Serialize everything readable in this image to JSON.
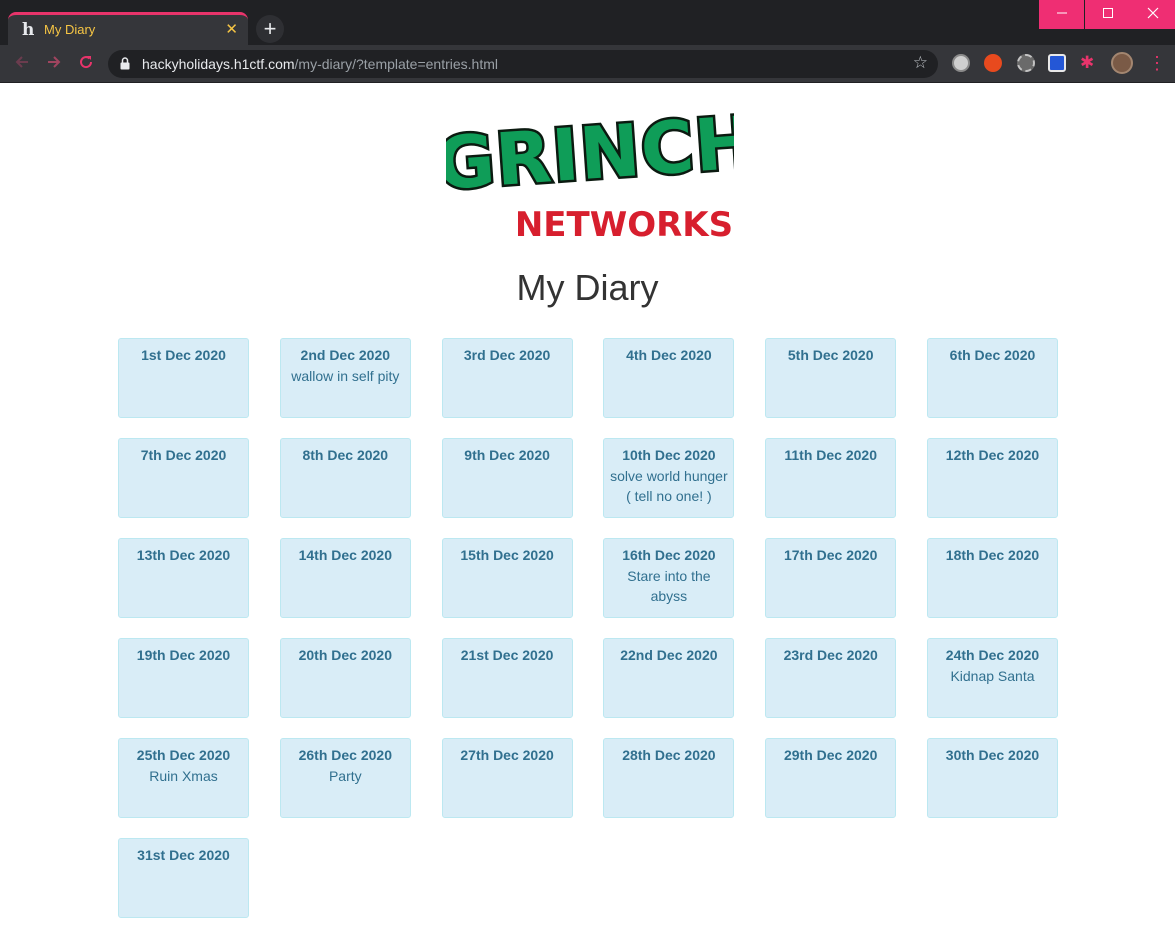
{
  "browser": {
    "tab_title": "My Diary",
    "tab_favicon": "h",
    "tab_close": "✕",
    "new_tab": "+",
    "url_host": "hackyholidays.h1ctf.com",
    "url_path": "/my-diary/?template=entries.html",
    "accent_color": "#e8346b"
  },
  "page": {
    "logo_top": "GRINCH",
    "logo_bottom": "NETWORKS",
    "title": "My Diary"
  },
  "entries": [
    {
      "date": "1st Dec 2020",
      "text": ""
    },
    {
      "date": "2nd Dec 2020",
      "text": "wallow in self pity"
    },
    {
      "date": "3rd Dec 2020",
      "text": ""
    },
    {
      "date": "4th Dec 2020",
      "text": ""
    },
    {
      "date": "5th Dec 2020",
      "text": ""
    },
    {
      "date": "6th Dec 2020",
      "text": ""
    },
    {
      "date": "7th Dec 2020",
      "text": ""
    },
    {
      "date": "8th Dec 2020",
      "text": ""
    },
    {
      "date": "9th Dec 2020",
      "text": ""
    },
    {
      "date": "10th Dec 2020",
      "text": "solve world hunger ( tell no one! )"
    },
    {
      "date": "11th Dec 2020",
      "text": ""
    },
    {
      "date": "12th Dec 2020",
      "text": ""
    },
    {
      "date": "13th Dec 2020",
      "text": ""
    },
    {
      "date": "14th Dec 2020",
      "text": ""
    },
    {
      "date": "15th Dec 2020",
      "text": ""
    },
    {
      "date": "16th Dec 2020",
      "text": "Stare into the abyss"
    },
    {
      "date": "17th Dec 2020",
      "text": ""
    },
    {
      "date": "18th Dec 2020",
      "text": ""
    },
    {
      "date": "19th Dec 2020",
      "text": ""
    },
    {
      "date": "20th Dec 2020",
      "text": ""
    },
    {
      "date": "21st Dec 2020",
      "text": ""
    },
    {
      "date": "22nd Dec 2020",
      "text": ""
    },
    {
      "date": "23rd Dec 2020",
      "text": ""
    },
    {
      "date": "24th Dec 2020",
      "text": "Kidnap Santa"
    },
    {
      "date": "25th Dec 2020",
      "text": "Ruin Xmas"
    },
    {
      "date": "26th Dec 2020",
      "text": "Party"
    },
    {
      "date": "27th Dec 2020",
      "text": ""
    },
    {
      "date": "28th Dec 2020",
      "text": ""
    },
    {
      "date": "29th Dec 2020",
      "text": ""
    },
    {
      "date": "30th Dec 2020",
      "text": ""
    },
    {
      "date": "31st Dec 2020",
      "text": ""
    }
  ]
}
